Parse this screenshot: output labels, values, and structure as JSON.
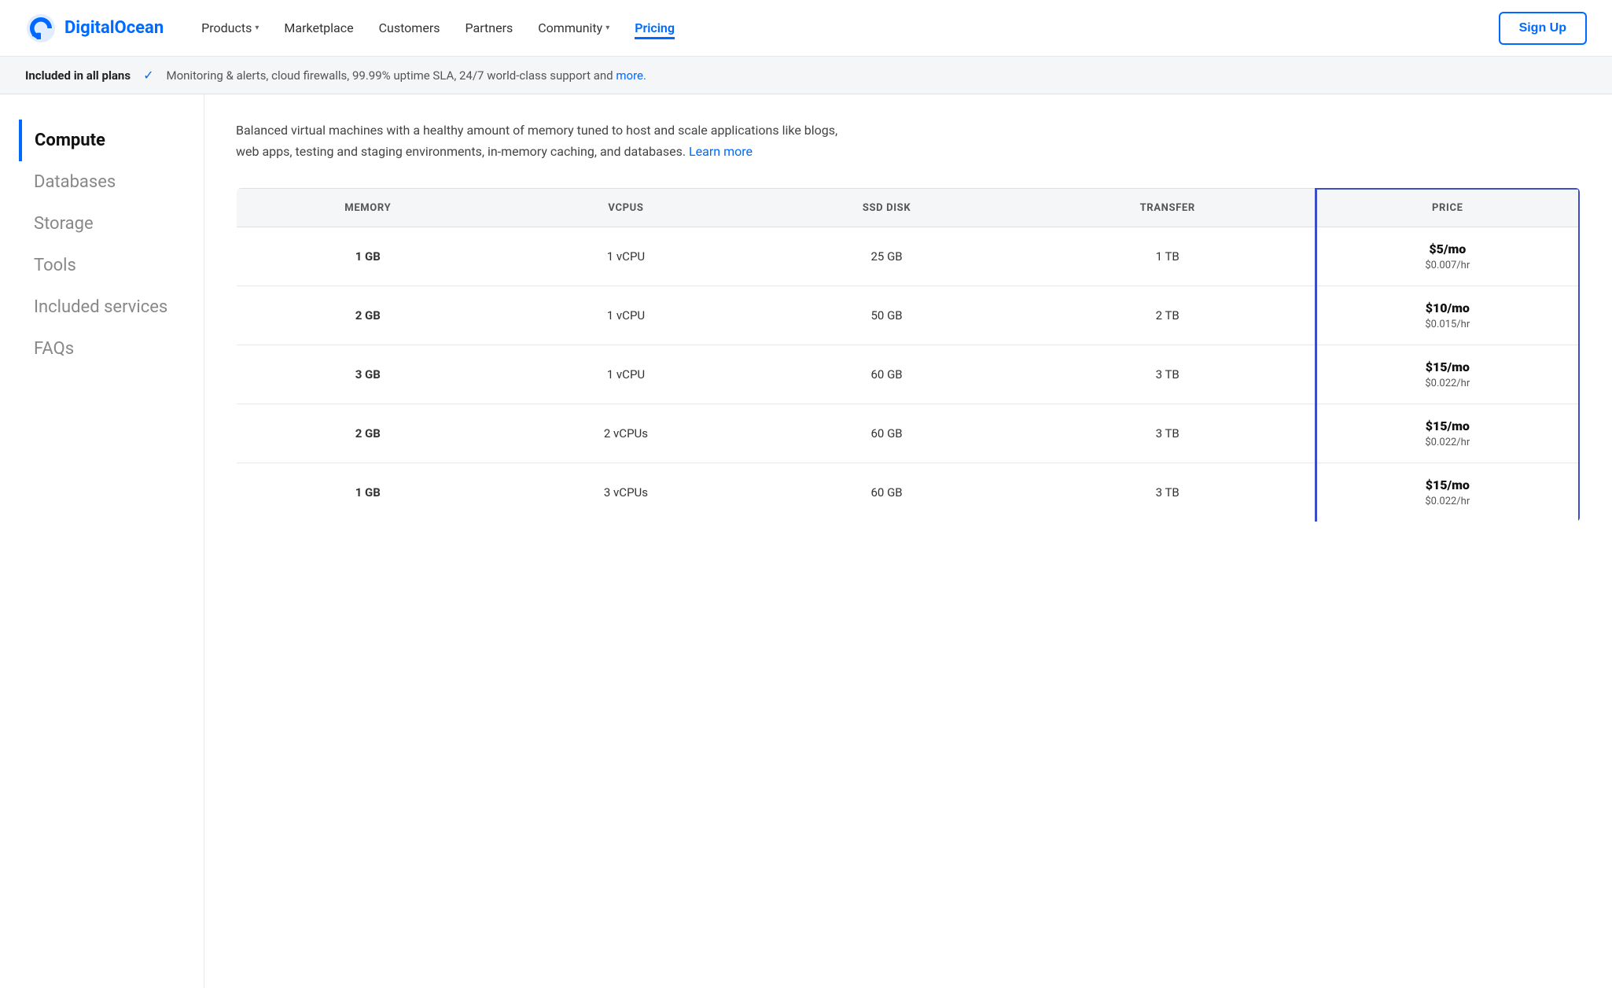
{
  "brand": {
    "name": "DigitalOcean",
    "logo_alt": "DigitalOcean logo"
  },
  "navbar": {
    "links": [
      {
        "label": "Products",
        "has_chevron": true,
        "active": false
      },
      {
        "label": "Marketplace",
        "has_chevron": false,
        "active": false
      },
      {
        "label": "Customers",
        "has_chevron": false,
        "active": false
      },
      {
        "label": "Partners",
        "has_chevron": false,
        "active": false
      },
      {
        "label": "Community",
        "has_chevron": true,
        "active": false
      },
      {
        "label": "Pricing",
        "has_chevron": false,
        "active": true
      }
    ],
    "cta": "Sign Up"
  },
  "included_bar": {
    "label": "Included in all plans",
    "description": "Monitoring & alerts, cloud firewalls, 99.99% uptime SLA, 24/7 world-class support and",
    "link_text": "more."
  },
  "sidebar": {
    "items": [
      {
        "label": "Compute",
        "active": true
      },
      {
        "label": "Databases",
        "active": false
      },
      {
        "label": "Storage",
        "active": false
      },
      {
        "label": "Tools",
        "active": false
      },
      {
        "label": "Included services",
        "active": false
      },
      {
        "label": "FAQs",
        "active": false
      }
    ]
  },
  "content": {
    "description": "Balanced virtual machines with a healthy amount of memory tuned to host and scale applications like blogs, web apps, testing and staging environments, in-memory caching, and databases.",
    "learn_more": "Learn more",
    "table": {
      "headers": [
        "MEMORY",
        "VCPUS",
        "SSD DISK",
        "TRANSFER",
        "PRICE"
      ],
      "rows": [
        {
          "memory": "1 GB",
          "vcpus": "1 vCPU",
          "ssd": "25 GB",
          "transfer": "1 TB",
          "price_mo": "$5/mo",
          "price_hr": "$0.007/hr"
        },
        {
          "memory": "2 GB",
          "vcpus": "1 vCPU",
          "ssd": "50 GB",
          "transfer": "2 TB",
          "price_mo": "$10/mo",
          "price_hr": "$0.015/hr"
        },
        {
          "memory": "3 GB",
          "vcpus": "1 vCPU",
          "ssd": "60 GB",
          "transfer": "3 TB",
          "price_mo": "$15/mo",
          "price_hr": "$0.022/hr"
        },
        {
          "memory": "2 GB",
          "vcpus": "2 vCPUs",
          "ssd": "60 GB",
          "transfer": "3 TB",
          "price_mo": "$15/mo",
          "price_hr": "$0.022/hr"
        },
        {
          "memory": "1 GB",
          "vcpus": "3 vCPUs",
          "ssd": "60 GB",
          "transfer": "3 TB",
          "price_mo": "$15/mo",
          "price_hr": "$0.022/hr"
        }
      ]
    }
  },
  "colors": {
    "accent": "#0069ff",
    "price_border": "#3c4dc9"
  }
}
